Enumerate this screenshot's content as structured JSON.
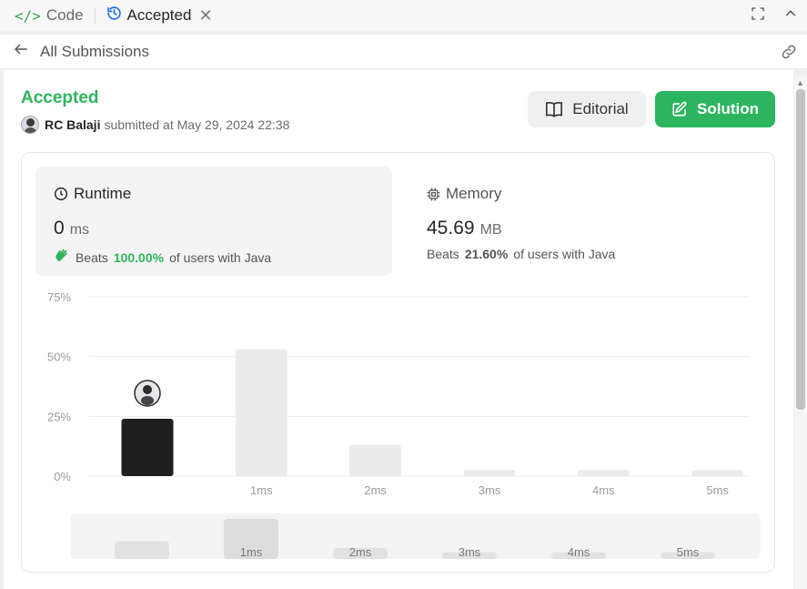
{
  "tabs": {
    "code_label": "Code",
    "accepted_label": "Accepted"
  },
  "header": {
    "back_label": "All Submissions"
  },
  "submission": {
    "status": "Accepted",
    "user": "RC Balaji",
    "submitted_text": "submitted at May 29, 2024 22:38"
  },
  "buttons": {
    "editorial": "Editorial",
    "solution": "Solution"
  },
  "runtime": {
    "title": "Runtime",
    "value": "0",
    "unit": "ms",
    "beats_prefix": "Beats",
    "beats_pct": "100.00%",
    "beats_suffix": "of users with Java"
  },
  "memory": {
    "title": "Memory",
    "value": "45.69",
    "unit": "MB",
    "beats_prefix": "Beats",
    "beats_pct": "21.60%",
    "beats_suffix": "of users with Java"
  },
  "colors": {
    "accent_green": "#2db55d",
    "solution_button": "#2cb55e",
    "user_bar": "#1f1f1f",
    "other_bar": "#ebebeb"
  },
  "icons": {
    "code": "code-icon",
    "accepted": "history-icon",
    "close": "close-icon",
    "fullscreen": "fullscreen-icon",
    "collapse": "chevron-up-icon",
    "back": "arrow-left-icon",
    "link": "link-icon",
    "editorial": "book-icon",
    "solution": "edit-icon",
    "runtime": "clock-icon",
    "memory": "chip-icon",
    "beats": "clap-icon"
  },
  "chart_data": {
    "type": "bar",
    "categories": [
      "0ms",
      "1ms",
      "2ms",
      "3ms",
      "4ms",
      "5ms"
    ],
    "tick_labels": [
      "",
      "1ms",
      "2ms",
      "3ms",
      "4ms",
      "5ms"
    ],
    "values": [
      24,
      53,
      13,
      2.5,
      2.5,
      2.5
    ],
    "highlight_index": 0,
    "y_ticks": [
      0,
      25,
      50,
      75
    ],
    "y_tick_labels": [
      "0%",
      "25%",
      "50%",
      "75%"
    ],
    "ylim": [
      0,
      75
    ],
    "grid": true,
    "overview_values": [
      8,
      18,
      5,
      3,
      3,
      3
    ],
    "overview_labels": [
      "",
      "1ms",
      "2ms",
      "3ms",
      "4ms",
      "5ms"
    ]
  }
}
